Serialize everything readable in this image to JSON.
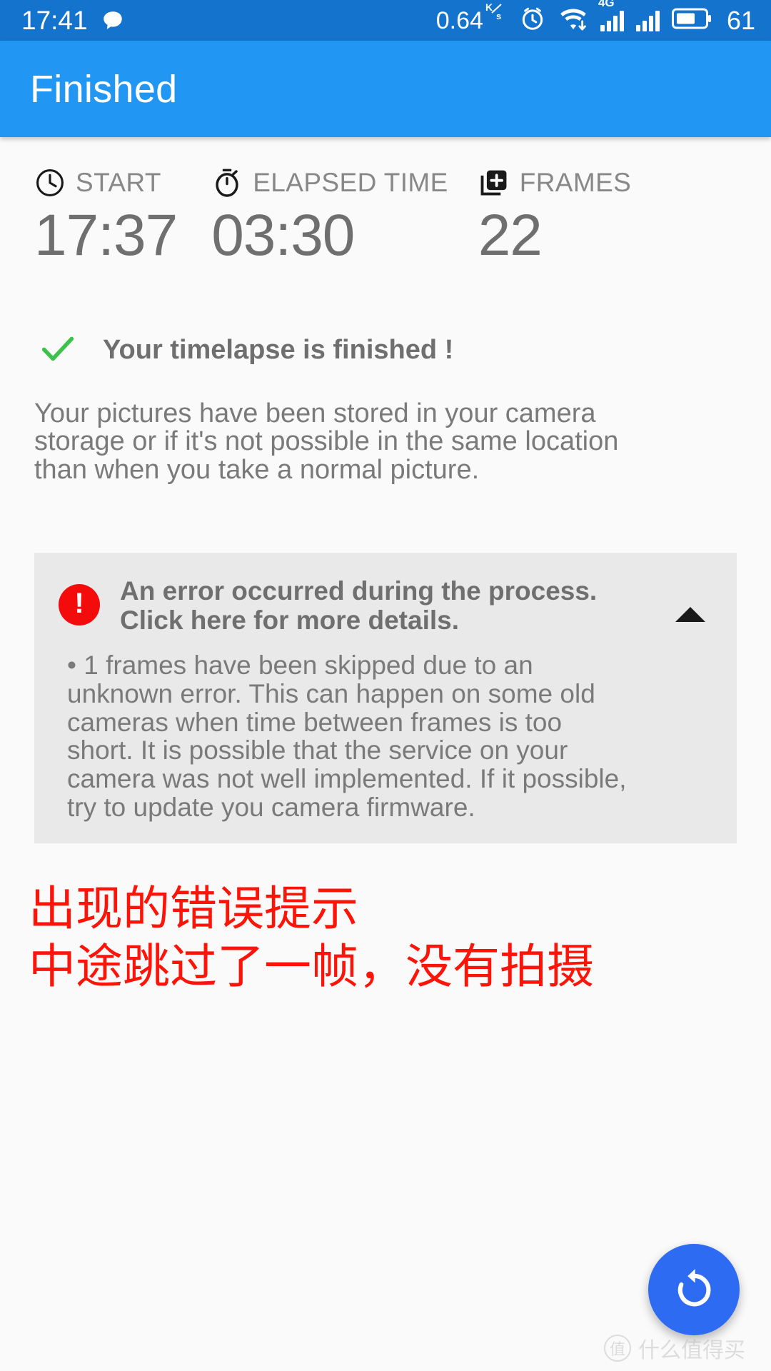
{
  "status_bar": {
    "time": "17:41",
    "message_icon": "message-bubble-icon",
    "network_speed": "0.64",
    "network_unit_top": "K",
    "network_unit_bottom": "s",
    "alarm_icon": "alarm-clock-icon",
    "wifi_icon": "wifi-download-icon",
    "mobile_label": "4G",
    "signal_icon": "signal-bars-icon",
    "battery_icon": "battery-icon",
    "battery_level": "61",
    "bg_color": "#1473cc"
  },
  "app_bar": {
    "title": "Finished",
    "bg_color": "#2196f3"
  },
  "stats": [
    {
      "icon": "clock-icon",
      "label": "START",
      "value": "17:37"
    },
    {
      "icon": "stopwatch-icon",
      "label": "ELAPSED TIME",
      "value": "03:30"
    },
    {
      "icon": "add-frame-icon",
      "label": "FRAMES",
      "value": "22"
    }
  ],
  "success": {
    "icon": "green-check-icon",
    "text": "Your timelapse is finished !",
    "color": "#3cc14b"
  },
  "paragraph": [
    "Your pictures have been stored in your camera",
    "storage or if it's not possible in the same location",
    "than when you take a normal picture."
  ],
  "error_card": {
    "badge_icon": "error-exclamation-icon",
    "badge_symbol": "!",
    "badge_color": "#f40b0b",
    "title_lines": [
      "An error occurred during the process.",
      "Click here for more details."
    ],
    "collapse_icon": "triangle-up-icon",
    "body_lines": [
      "• 1 frames have been skipped due to an",
      "unknown error. This can happen on some old",
      "cameras when time between frames is too",
      "short. It is possible that the service on your",
      "camera was not well implemented. If it possible,",
      "try to update you camera firmware."
    ]
  },
  "annotation": {
    "lines": [
      "出现的错误提示",
      "中途跳过了一帧，没有拍摄"
    ],
    "color": "#fc1408"
  },
  "fab": {
    "icon": "restore-replay-icon",
    "color": "#2c6bf2"
  },
  "watermark": {
    "badge": "值",
    "text": "什么值得买"
  }
}
